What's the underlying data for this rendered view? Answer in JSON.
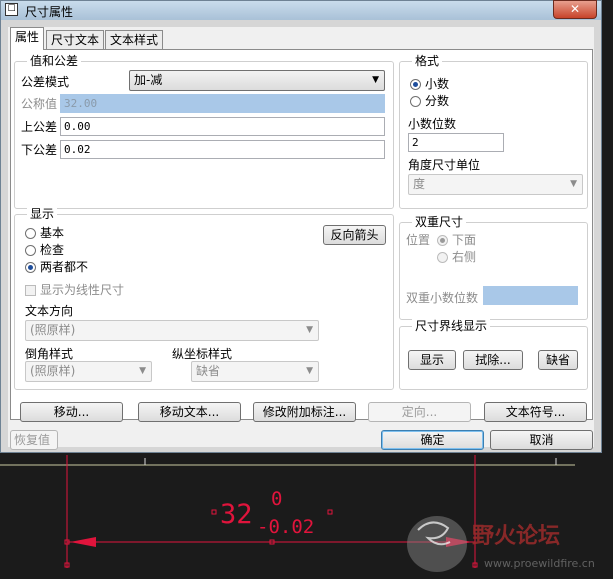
{
  "window": {
    "title": "尺寸属性",
    "close_symbol": "✕"
  },
  "tabs": [
    "属性",
    "尺寸文本",
    "文本样式"
  ],
  "value_tolerance": {
    "group_title": "值和公差",
    "tolerance_mode_label": "公差模式",
    "tolerance_mode_value": "加-减",
    "nominal_label": "公称值",
    "nominal_value": "32.00",
    "upper_label": "上公差",
    "upper_value": "0.00",
    "lower_label": "下公差",
    "lower_value": "0.02"
  },
  "format": {
    "group_title": "格式",
    "decimal_label": "小数",
    "fraction_label": "分数",
    "decimals_label": "小数位数",
    "decimals_value": "2",
    "angle_unit_label": "角度尺寸单位",
    "angle_unit_value": "度"
  },
  "display": {
    "group_title": "显示",
    "basic_label": "基本",
    "inspect_label": "检查",
    "neither_label": "两者都不",
    "flip_arrows_button": "反向箭头",
    "linear_label": "显示为线性尺寸",
    "text_orientation_label": "文本方向",
    "text_orientation_value": "(照原样)",
    "chamfer_style_label": "倒角样式",
    "chamfer_style_value": "(照原样)",
    "ordinate_style_label": "纵坐标样式",
    "ordinate_style_value": "缺省"
  },
  "dual_dimension": {
    "group_title": "双重尺寸",
    "position_label": "位置",
    "below_label": "下面",
    "right_label": "右侧",
    "dual_decimals_label": "双重小数位数"
  },
  "witness_line": {
    "group_title": "尺寸界线显示",
    "show_button": "显示",
    "erase_button": "拭除...",
    "default_button": "缺省"
  },
  "actions": {
    "move": "移动...",
    "move_text": "移动文本...",
    "edit_attach": "修改附加标注...",
    "orient": "定向...",
    "text_symbol": "文本符号...",
    "restore": "恢复值",
    "ok": "确定",
    "cancel": "取消"
  },
  "drawing": {
    "dim_value": "32",
    "tol_upper": "0",
    "tol_lower": "-0.02",
    "watermark_text": "野火论坛",
    "watermark_url": "www.proewildfire.cn"
  },
  "colors": {
    "dimension": "#e0143c",
    "selection": "#a9c8e8",
    "watermark": "#9c2b2b"
  }
}
